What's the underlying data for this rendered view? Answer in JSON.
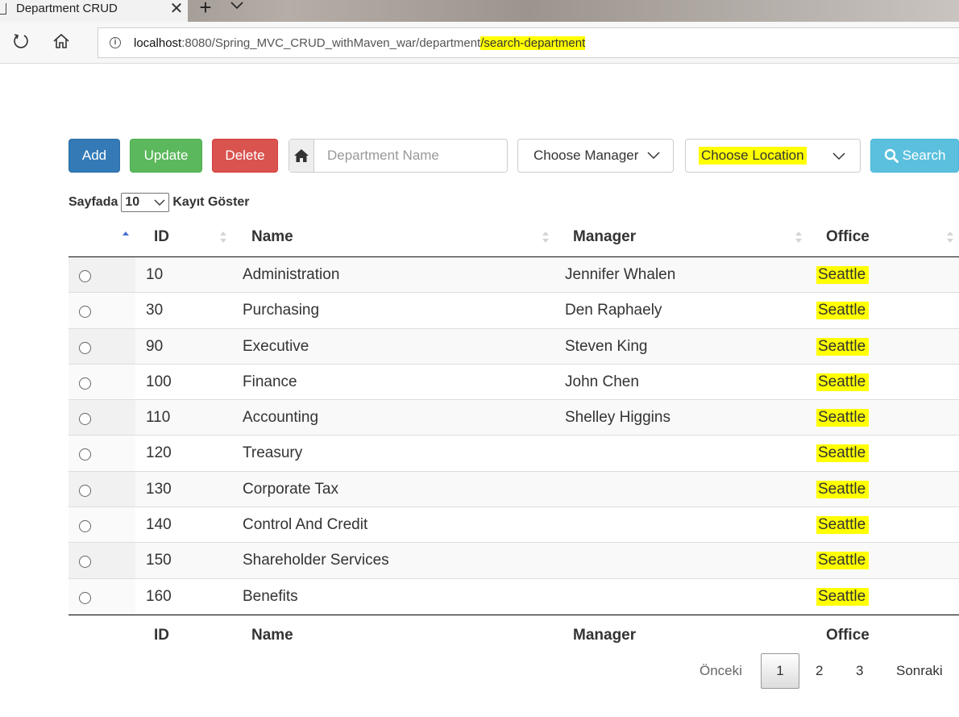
{
  "browser": {
    "tab_title": "Department CRUD",
    "url_host": "localhost",
    "url_path": ":8080/Spring_MVC_CRUD_withMaven_war/department",
    "url_highlight": "/search-department"
  },
  "toolbar": {
    "add_label": "Add",
    "update_label": "Update",
    "delete_label": "Delete",
    "department_placeholder": "Department Name",
    "manager_select": "Choose Manager",
    "location_select": "Choose Location",
    "search_label": "Search"
  },
  "length": {
    "prefix": "Sayfada",
    "value": "10",
    "suffix": "Kayıt Göster"
  },
  "table": {
    "columns": [
      "ID",
      "Name",
      "Manager",
      "Office"
    ],
    "rows": [
      {
        "id": "10",
        "name": "Administration",
        "manager": "Jennifer Whalen",
        "office": "Seattle"
      },
      {
        "id": "30",
        "name": "Purchasing",
        "manager": "Den Raphaely",
        "office": "Seattle"
      },
      {
        "id": "90",
        "name": "Executive",
        "manager": "Steven King",
        "office": "Seattle"
      },
      {
        "id": "100",
        "name": "Finance",
        "manager": "John Chen",
        "office": "Seattle"
      },
      {
        "id": "110",
        "name": "Accounting",
        "manager": "Shelley Higgins",
        "office": "Seattle"
      },
      {
        "id": "120",
        "name": "Treasury",
        "manager": "",
        "office": "Seattle"
      },
      {
        "id": "130",
        "name": "Corporate Tax",
        "manager": "",
        "office": "Seattle"
      },
      {
        "id": "140",
        "name": "Control And Credit",
        "manager": "",
        "office": "Seattle"
      },
      {
        "id": "150",
        "name": "Shareholder Services",
        "manager": "",
        "office": "Seattle"
      },
      {
        "id": "160",
        "name": "Benefits",
        "manager": "",
        "office": "Seattle"
      }
    ]
  },
  "pagination": {
    "prev": "Önceki",
    "pages": [
      "1",
      "2",
      "3"
    ],
    "current": "1",
    "next": "Sonraki"
  },
  "colors": {
    "add": "#337ab7",
    "update": "#5cb85c",
    "delete": "#d9534f",
    "search": "#5bc0de",
    "highlight": "#ffff00"
  }
}
